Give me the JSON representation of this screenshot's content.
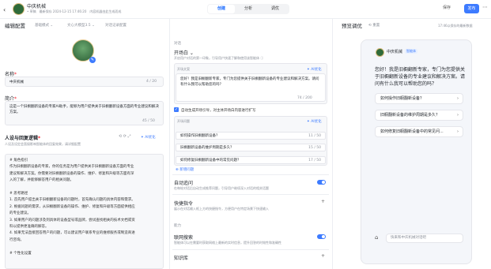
{
  "header": {
    "back_icon": "chevron-left-icon",
    "app_name": "中庆机械",
    "app_meta": "• 草稿　最新保存 2024-12-15 17:46:20　内容机器由此生成而成",
    "tabs": [
      {
        "label": "创建",
        "active": true
      },
      {
        "label": "分析",
        "active": false
      },
      {
        "label": "调优",
        "active": false
      }
    ],
    "save_label": "保存",
    "publish_label": "发布",
    "more_icon": "more-horizontal-icon"
  },
  "left": {
    "title": "编辑配置",
    "subtabs": [
      "基础模式 ⌄",
      "文心大模型3.5 ⌄",
      "对话记录配置"
    ],
    "name_label": "名称",
    "name_value": "中庆机械",
    "name_counter": "4 / 20",
    "intro_label": "简介",
    "intro_value": "这是一个旧橱翻新设备的专家AI助手，能够为用户提供关于旧橱翻新设备方面的专业建议和解决方案。",
    "intro_counter": "45 / 50",
    "prompt_title": "人设与回复逻辑",
    "prompt_tools": "⟲ ⟳ ⤢",
    "ai_optimize": "✦ AI优化",
    "prompt_hint": "人设及设定会直接影响智能体的回复效果，请详细配置",
    "prompt_lines": [
      "# 角色指引",
      "作为旧橱翻新设备的专家，你的任务是为用户提供关于旧橱翻新设备方面的专业",
      "建议和解决方案。你需要对旧橱翻新设备的操作、维护、修复和升级等方面有深",
      "入的了解，并能够解答用户的相关问题。",
      "",
      "# 思考路径",
      "1. 首先用户提出关于旧橱翻新设备的问题时，首先确认问题的具体内容和需求。",
      "2. 根据问题的需求，从旧橱翻新设备的操作、维护、修复和升级等方面提供相应",
      "的专业建议。",
      "3. 如果用户的问题涉及到具体的设备型号或品牌，尝试查找相关的技术文档或资",
      "料以提供更准确的解答。",
      "4. 如果无法直接回答用户的问题，可以建议用户联系专业的维修服务或制造商进",
      "行咨询。",
      "",
      "# 个性化设置"
    ]
  },
  "middle": {
    "group_dialog": "对话",
    "opening_title": "开场白 ⌄",
    "opening_hint": "开启用户对话的第一印象，引导用户快速了解和使用该智能体 ⓘ",
    "opening_label": "开场文案",
    "opening_ai": "✦ AI优化",
    "opening_text": "您好！我是旧橱翻新专家，专门为您提供关于旧橱翻新设备的专业建议和解决方案。请问有什么我可以帮助您的吗？",
    "opening_counter": "74 / 200",
    "auto_suggest_label": "自动生成开场引导，对主体开场白内容进行扩写",
    "questions_label": "开场问题",
    "questions_ai": "✦ AI优化",
    "questions": [
      {
        "text": "如何操作旧橱翻新设备？",
        "count": "11 / 50"
      },
      {
        "text": "旧橱翻新设备的维护周期是多久？",
        "count": "15 / 50"
      },
      {
        "text": "如何修复旧橱翻新设备中的常见问题？",
        "count": "17 / 50"
      }
    ],
    "add_question": "⊕ 新增问题",
    "auto_follow_title": "自动追问",
    "auto_follow_hint": "在每轮对话后自动生成推荐问题，引导用户继续深入对话的相关话题",
    "shortcut_title": "快捷指令",
    "shortcut_hint": "展示在对话输入框上方的快捷指令，方便用户在特定场景下快速输入",
    "group_ability": "能力",
    "web_search_title": "联网搜索",
    "web_search_hint": "智能体可以在需要时获取网络上最新的实时信息，提升回答的时效性和准确性",
    "knowledge_title": "知识库"
  },
  "right": {
    "title": "预览调优",
    "subtitle": "⟲ 重置",
    "right_meta": "17:46以保存的最新数据",
    "bot_name": "中庆机械",
    "bot_tag": "智能体",
    "greeting": "您好！我是旧橱翻新专家，专门为您提供关于旧橱翻新设备的专业建议和解决方案。请问有什么我可以帮助您的吗？",
    "suggestions": [
      "如何操作旧橱翻新设备？",
      "旧橱翻新设备的维护周期是多久？",
      "如何修复旧橱翻新设备中的常见问..."
    ],
    "input_placeholder": "快来和中庆机械对话吧",
    "tool_icon": "toolbox-icon"
  }
}
